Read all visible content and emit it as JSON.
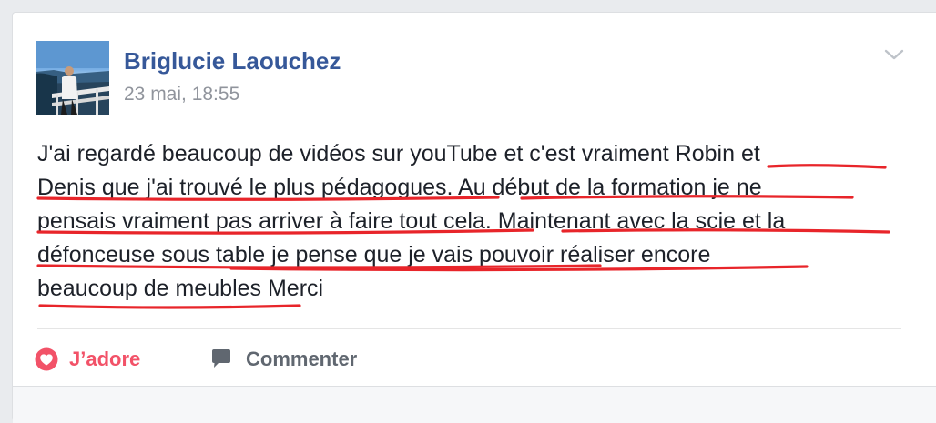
{
  "post": {
    "author": "Briglucie Laouchez",
    "timestamp": "23 mai, 18:55",
    "text_lines": [
      "J'ai regardé beaucoup de vidéos sur youTube et c'est vraiment Robin et",
      "Denis que j'ai trouvé le plus pédagogues. Au début de la formation je ne",
      "pensais vraiment pas arriver à faire tout cela. Maintenant avec la scie et la",
      "défonceuse sous table je pense que je vais pouvoir réaliser encore",
      "beaucoup de meubles Merci"
    ]
  },
  "actions": {
    "love_label": "J’adore",
    "comment_label": "Commenter"
  },
  "icons": {
    "avatar": "profile-photo",
    "menu": "chevron-down-icon",
    "love": "heart-icon",
    "comment": "speech-bubble-icon"
  },
  "colors": {
    "author_link": "#365899",
    "timestamp": "#90949c",
    "body_text": "#1d2129",
    "love_active": "#f25268",
    "comment_text": "#606770",
    "annotation_underline": "#e8252a"
  }
}
